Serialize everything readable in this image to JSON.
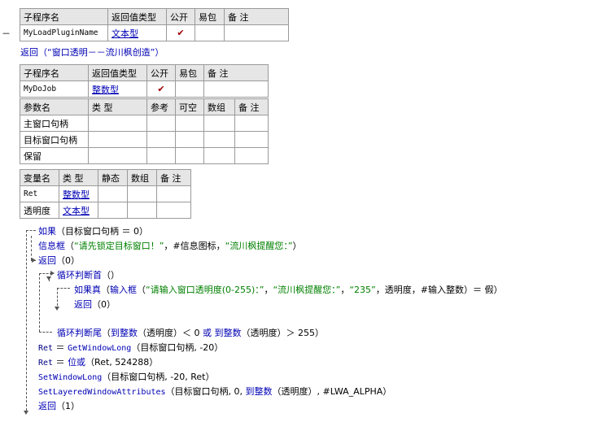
{
  "sub1": {
    "headers": [
      "子程序名",
      "返回值类型",
      "公开",
      "易包",
      "备 注"
    ],
    "name": "MyLoadPluginName",
    "return_type": "文本型",
    "public_check": "✔"
  },
  "line_return1": "返回（“窗口透明－－流川枫创造”）",
  "dash_mark": "－",
  "sub2": {
    "headers": [
      "子程序名",
      "返回值类型",
      "公开",
      "易包",
      "备 注"
    ],
    "name": "MyDoJob",
    "return_type": "整数型",
    "public_check": "✔",
    "param_headers": [
      "参数名",
      "类 型",
      "参考",
      "可空",
      "数组",
      "备 注"
    ],
    "params": [
      "主窗口句柄",
      "目标窗口句柄",
      "保留"
    ]
  },
  "vars": {
    "headers": [
      "变量名",
      "类 型",
      "静态",
      "数组",
      "备 注"
    ],
    "rows": [
      {
        "name": "Ret",
        "type": "整数型"
      },
      {
        "name": "透明度",
        "type": "文本型"
      }
    ]
  },
  "code": {
    "l1_kw": "如果",
    "l1_rest": "（目标窗口句柄 ＝ 0）",
    "l2_fn": "信息框",
    "l2_a": "（",
    "l2_s1": "“请先锁定目标窗口！”",
    "l2_b": "，#信息图标，",
    "l2_s2": "“流川枫提醒您：”",
    "l2_c": "）",
    "l3_kw": "返回",
    "l3_rest": "（0）",
    "l4_kw": "循环判断首",
    "l4_rest": "（）",
    "l5_kw": "如果真",
    "l5_a": "（",
    "l5_fn": "输入框",
    "l5_b": "（",
    "l5_s1": "“请输入窗口透明度(0-255)：”",
    "l5_c": "，",
    "l5_s2": "“流川枫提醒您：”",
    "l5_d": "，",
    "l5_s3": "“235”",
    "l5_e": "，透明度，#输入整数）＝ 假）",
    "l6_kw": "返回",
    "l6_rest": "（0）",
    "l7_kw": "循环判断尾",
    "l7_a": "（",
    "l7_fn1": "到整数",
    "l7_b": "（透明度）＜ 0 ",
    "l7_or": "或",
    "l7_c": " ",
    "l7_fn2": "到整数",
    "l7_d": "（透明度）＞ 255）",
    "l8_var": "Ret",
    "l8_eq": " ＝ ",
    "l8_fn": "GetWindowLong",
    "l8_rest": "（目标窗口句柄, -20）",
    "l9_var": "Ret",
    "l9_eq": " ＝ ",
    "l9_fn": "位或",
    "l9_rest": "（Ret, 524288）",
    "l10_fn": "SetWindowLong",
    "l10_rest": "（目标窗口句柄, -20, Ret）",
    "l11_fn": "SetLayeredWindowAttributes",
    "l11_rest": "（目标窗口句柄, 0, ",
    "l11_fn2": "到整数",
    "l11_rest2": "（透明度）, #LWA_ALPHA）",
    "l12_kw": "返回",
    "l12_rest": "（1）"
  }
}
